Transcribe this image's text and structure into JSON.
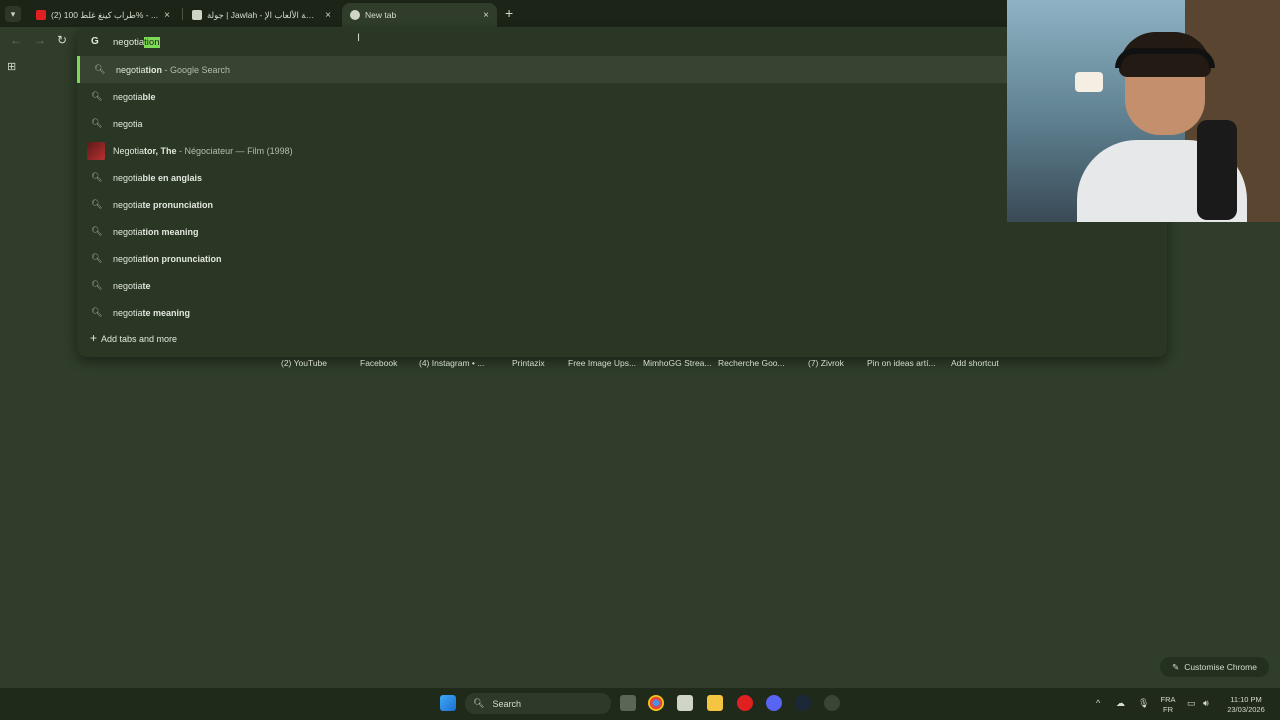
{
  "tabs": [
    {
      "title": "(2) طراب كينغ غلط 100% - ...",
      "active": false
    },
    {
      "title": "جولة | Jawlah - منصة الألعاب الإ...",
      "active": false
    },
    {
      "title": "New tab",
      "active": true
    }
  ],
  "tab_close": "×",
  "new_tab": "+",
  "omnibox": {
    "typed": "negotia",
    "completion": "tion",
    "logo": "G"
  },
  "suggestions": [
    {
      "prefix": "negotia",
      "bold": "tion",
      "meta": " - Google Search",
      "kind": "search"
    },
    {
      "prefix": "negotia",
      "bold": "ble",
      "meta": "",
      "kind": "search"
    },
    {
      "prefix": "negotia",
      "bold": "",
      "meta": "",
      "kind": "search"
    },
    {
      "prefix": "Negotia",
      "bold": "tor, The",
      "meta": " - Négociateur — Film (1998)",
      "kind": "entity"
    },
    {
      "prefix": "negotia",
      "bold": "ble en anglais",
      "meta": "",
      "kind": "search"
    },
    {
      "prefix": "negotia",
      "bold": "te pronunciation",
      "meta": "",
      "kind": "search"
    },
    {
      "prefix": "negotia",
      "bold": "tion meaning",
      "meta": "",
      "kind": "search"
    },
    {
      "prefix": "negotia",
      "bold": "tion pronunciation",
      "meta": "",
      "kind": "search"
    },
    {
      "prefix": "negotia",
      "bold": "te",
      "meta": "",
      "kind": "search"
    },
    {
      "prefix": "negotia",
      "bold": "te meaning",
      "meta": "",
      "kind": "search"
    }
  ],
  "add_tabs_label": "Add tabs and more",
  "shortcuts": [
    "(2) YouTube",
    "Facebook",
    "(4) Instagram • ...",
    "Printazix",
    "Free Image Ups...",
    "MimhoGG Strea...",
    "Recherche Goo...",
    "(7) Zivrok",
    "Pin on ideas artí...",
    "Add shortcut"
  ],
  "customise_label": "Customise Chrome",
  "taskbar": {
    "search_label": "Search",
    "lang_top": "FRA",
    "lang_bottom": "FR",
    "time": "11:10 PM",
    "date": "23/03/2026"
  },
  "colors": {
    "accent": "#7ed957",
    "background": "#2f3d2a"
  }
}
